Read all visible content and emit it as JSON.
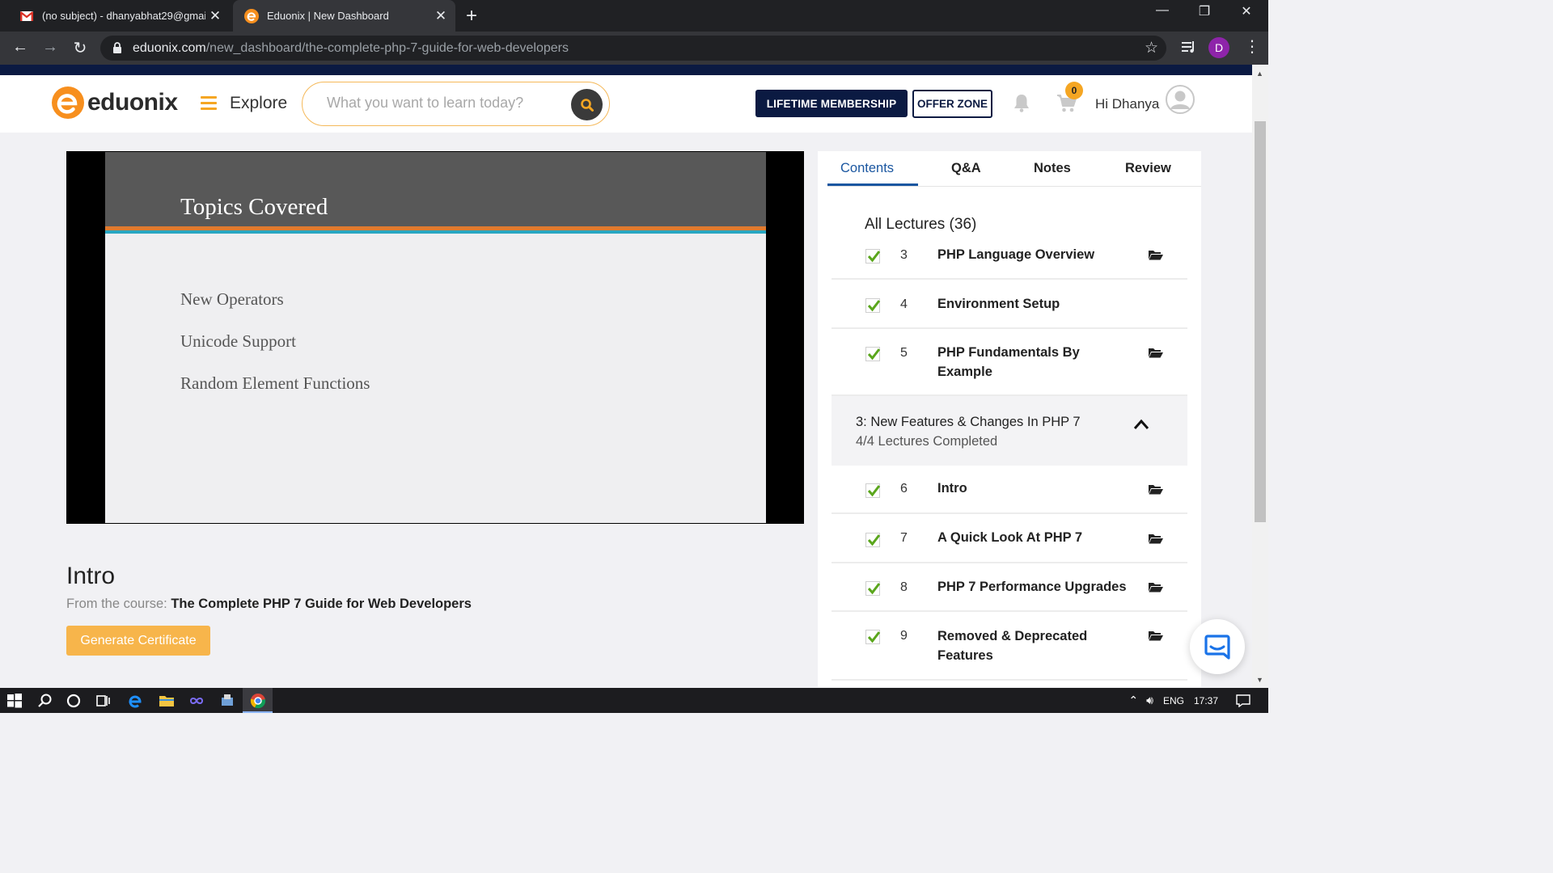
{
  "browser": {
    "tabs": [
      {
        "title": "(no subject) - dhanyabhat29@gmail.com",
        "icon": "gmail-icon",
        "active": false
      },
      {
        "title": "Eduonix | New Dashboard",
        "icon": "eduonix-icon",
        "active": true
      }
    ],
    "url_domain": "eduonix.com",
    "url_path": "/new_dashboard/the-complete-php-7-guide-for-web-developers",
    "profile_initial": "D"
  },
  "header": {
    "logo_text": "eduonix",
    "explore_label": "Explore",
    "search_placeholder": "What you want to learn today?",
    "lifetime_label": "LIFETIME MEMBERSHIP",
    "offer_label": "OFFER ZONE",
    "cart_count": "0",
    "greeting": "Hi Dhanya"
  },
  "slide": {
    "title": "Topics Covered",
    "bullets": [
      "New Operators",
      "Unicode Support",
      "Random Element Functions"
    ]
  },
  "lecture": {
    "title": "Intro",
    "course_prefix": "From the course:",
    "course_name": "The Complete PHP 7 Guide for Web Developers",
    "certificate_label": "Generate Certificate"
  },
  "panel": {
    "tabs": [
      "Contents",
      "Q&A",
      "Notes",
      "Review"
    ],
    "all_lectures": "All Lectures (36)",
    "lectures_a": [
      {
        "num": "3",
        "name": "PHP Language Overview",
        "folder": true
      },
      {
        "num": "4",
        "name": "Environment Setup",
        "folder": false
      },
      {
        "num": "5",
        "name": "PHP Fundamentals By Example",
        "folder": true
      }
    ],
    "section": {
      "title": "3: New Features & Changes In PHP 7",
      "progress": "4/4 Lectures Completed"
    },
    "lectures_b": [
      {
        "num": "6",
        "name": "Intro",
        "folder": true
      },
      {
        "num": "7",
        "name": "A Quick Look At PHP 7",
        "folder": true
      },
      {
        "num": "8",
        "name": "PHP 7 Performance Upgrades",
        "folder": true
      },
      {
        "num": "9",
        "name": "Removed & Deprecated Features",
        "folder": true
      }
    ]
  },
  "taskbar": {
    "language": "ENG",
    "time": "17:37"
  },
  "colors": {
    "brand_orange": "#f78f1e",
    "navy": "#0b1a42",
    "accent_blue": "#1a56a0",
    "check_green": "#5aa61c",
    "cert_yellow": "#f7b54b"
  }
}
